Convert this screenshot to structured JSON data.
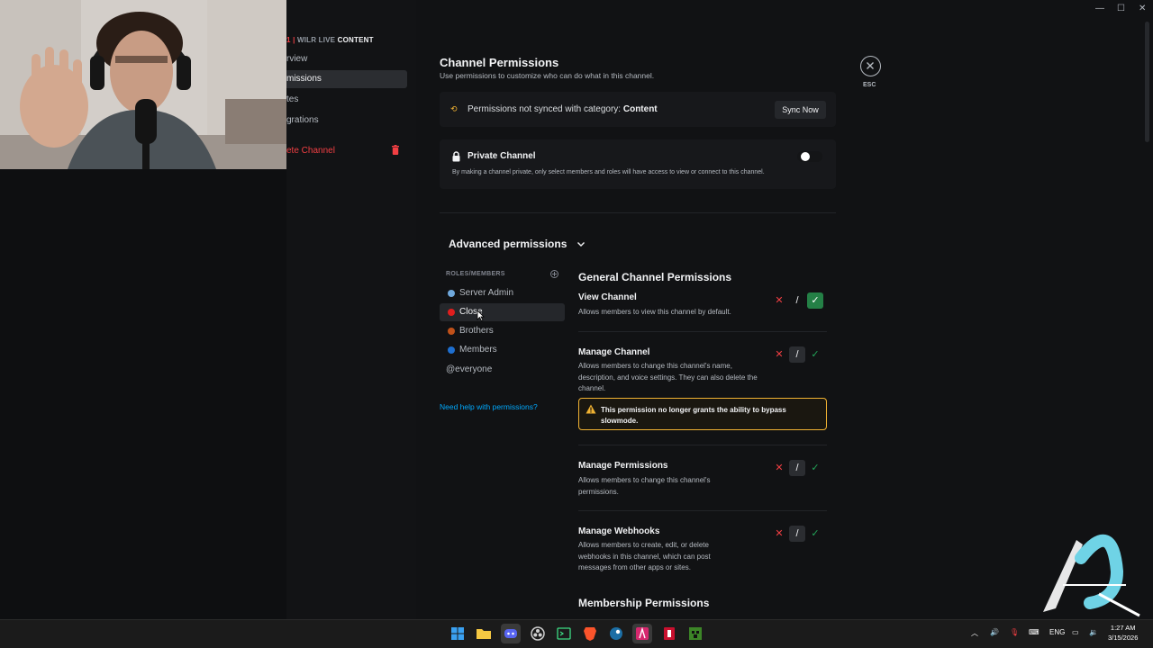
{
  "window_controls": {
    "minimize": "—",
    "maximize": "☐",
    "close": "✕"
  },
  "sidebar": {
    "header_prefix": "1 |",
    "header_server": "WILR LIVE",
    "header_channel": "CONTENT",
    "items": [
      {
        "label": "rview"
      },
      {
        "label": "missions"
      },
      {
        "label": "tes"
      },
      {
        "label": "grations"
      },
      {
        "label": "ete Channel"
      }
    ]
  },
  "header": {
    "title": "Channel Permissions",
    "subtitle": "Use permissions to customize who can do what in this channel.",
    "esc_label": "ESC"
  },
  "sync": {
    "text": "Permissions not synced with category:",
    "category": "Content",
    "button": "Sync Now"
  },
  "private_channel": {
    "title": "Private Channel",
    "description": "By making a channel private, only select members and roles will have access to view or connect to this channel.",
    "enabled": false
  },
  "advanced": {
    "title": "Advanced permissions",
    "roles_header": "ROLES/MEMBERS",
    "roles": [
      {
        "name": "Server Admin",
        "color": "#6fa8dc"
      },
      {
        "name": "Close",
        "color": "#e01e1e"
      },
      {
        "name": "Brothers",
        "color": "#c0511a"
      },
      {
        "name": "Members",
        "color": "#1e6fd0"
      },
      {
        "name": "@everyone",
        "color": ""
      }
    ],
    "selected_role": "Close",
    "help_link": "Need help with permissions?"
  },
  "permissions": {
    "section_general": "General Channel Permissions",
    "section_membership": "Membership Permissions",
    "items": [
      {
        "name": "View Channel",
        "description": "Allows members to view this channel by default.",
        "state": "allow"
      },
      {
        "name": "Manage Channel",
        "description": "Allows members to change this channel's name, description, and voice settings. They can also delete the channel.",
        "state": "neutral"
      },
      {
        "name": "Manage Permissions",
        "description": "Allows members to change this channel's permissions.",
        "state": "neutral"
      },
      {
        "name": "Manage Webhooks",
        "description": "Allows members to create, edit, or delete webhooks in this channel, which can post messages from other apps or sites.",
        "state": "neutral"
      }
    ],
    "symbols": {
      "deny": "✕",
      "neutral": "/",
      "allow": "✓"
    },
    "warning": "This permission no longer grants the ability to bypass slowmode."
  },
  "taskbar": {
    "tray_lang": "ENG",
    "time": "1:27 AM",
    "date": "3/15/2026"
  },
  "colors": {
    "accent_green": "#248046",
    "deny_red": "#f23f43",
    "warning_yellow": "#f0b232",
    "link_blue": "#00a8fc"
  }
}
